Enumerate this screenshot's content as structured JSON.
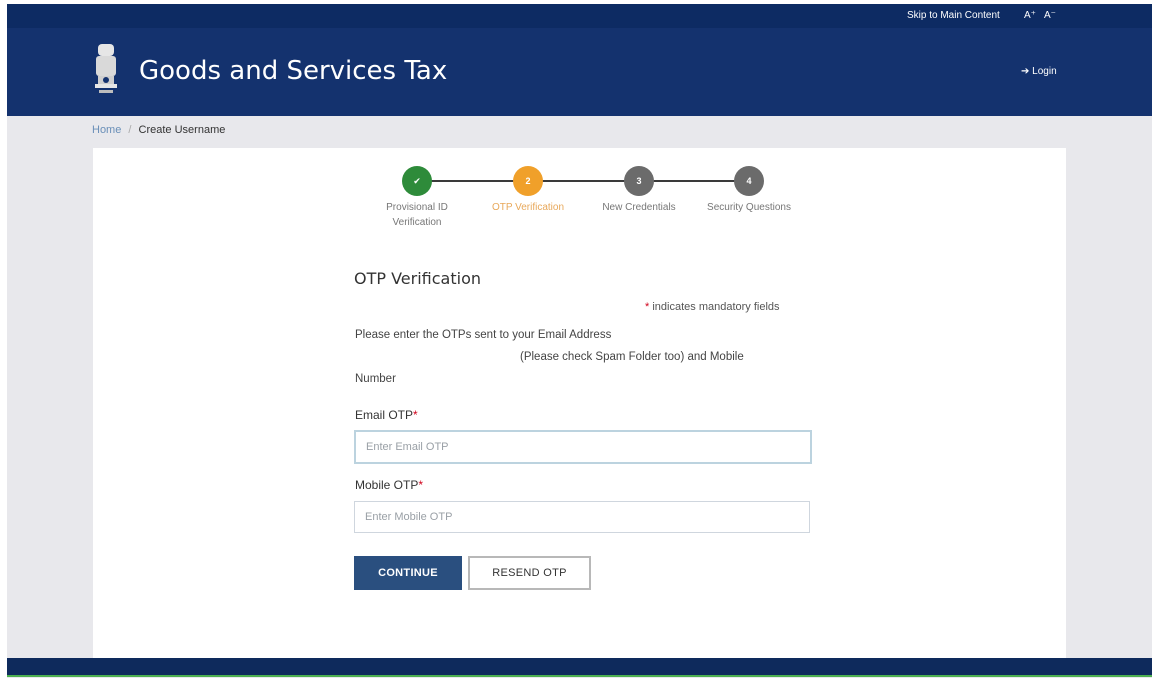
{
  "topbar": {
    "skip_link": "Skip to Main Content",
    "font_increase": "A⁺",
    "font_decrease": "A⁻"
  },
  "header": {
    "title": "Goods and Services Tax",
    "login_label": "➔ Login"
  },
  "breadcrumb": {
    "home": "Home",
    "current": "Create Username"
  },
  "stepper": {
    "steps": [
      {
        "number": "✔",
        "label": "Provisional ID Verification",
        "status": "completed",
        "color": "#2e8b3a"
      },
      {
        "number": "2",
        "label": "OTP Verification",
        "status": "active",
        "color": "#f0a02a"
      },
      {
        "number": "3",
        "label": "New Credentials",
        "status": "pending",
        "color": "#6b6b6b"
      },
      {
        "number": "4",
        "label": "Security Questions",
        "status": "pending",
        "color": "#6b6b6b"
      }
    ]
  },
  "form": {
    "title": "OTP Verification",
    "mandatory_note": "indicates mandatory fields",
    "instruction_line1": "Please enter the OTPs sent to your Email Address",
    "instruction_line2": "(Please check Spam Folder too) and Mobile",
    "instruction_line3": "Number",
    "email_label": "Email OTP",
    "email_placeholder": "Enter Email OTP",
    "email_value": "",
    "mobile_label": "Mobile OTP",
    "mobile_placeholder": "Enter Mobile OTP",
    "mobile_value": "",
    "continue_label": "CONTINUE",
    "resend_label": "RESEND OTP"
  },
  "colors": {
    "header_bg": "#14326e",
    "primary_button": "#2a4f7f",
    "required_marker": "#d0021b",
    "active_step": "#f0a02a",
    "active_step_text": "#e8a85a"
  }
}
